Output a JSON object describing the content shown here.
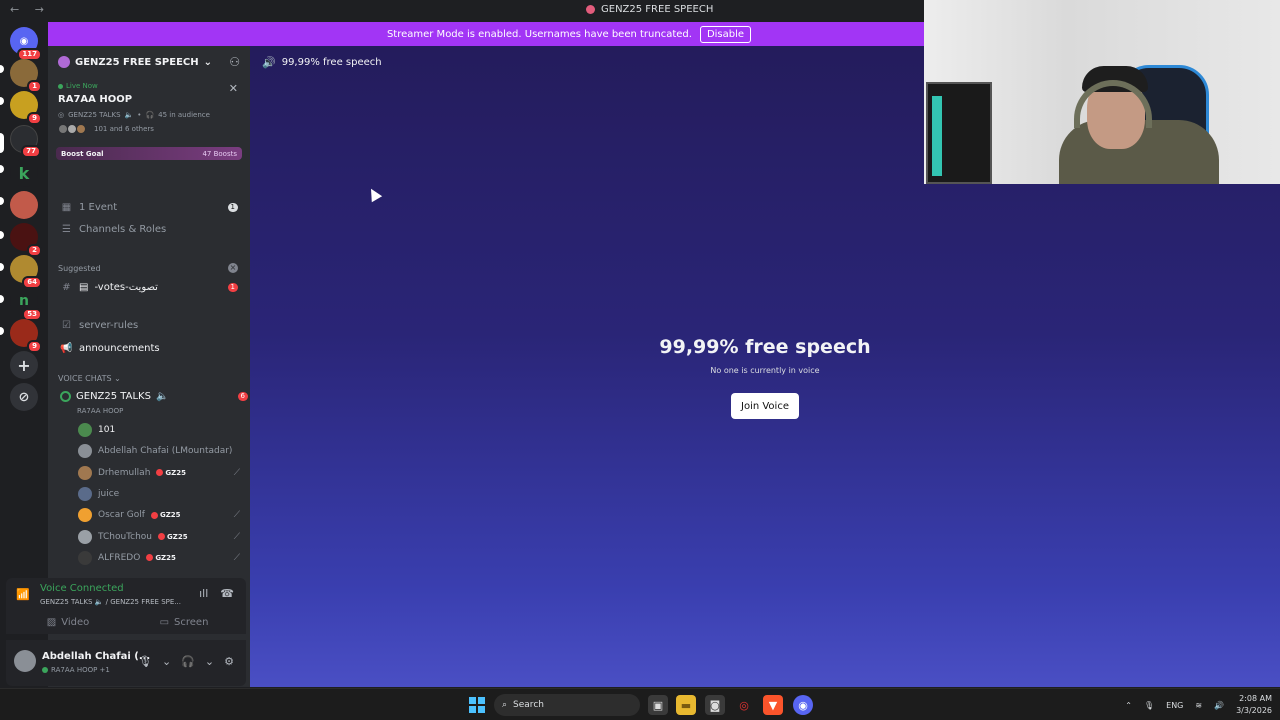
{
  "titlebar": {
    "title": "GENZ25 FREE SPEECH",
    "nav": "← →"
  },
  "streamer": {
    "message": "Streamer Mode is enabled. Usernames have been truncated.",
    "button": "Disable"
  },
  "rail": {
    "badges": [
      "117",
      "1",
      "9",
      "77",
      "2",
      "64",
      "53",
      "9"
    ]
  },
  "sidebar": {
    "server_name": "GENZ25 FREE SPEECH",
    "live": {
      "label": "Live Now",
      "who": "RA7AA HOOP",
      "channel": "GENZ25 TALKS",
      "audience": "45 in audience",
      "others": "101 and 6 others"
    },
    "boost": {
      "label": "Boost Goal",
      "count": "47 Boosts"
    },
    "events": {
      "label": "1 Event",
      "count": "1"
    },
    "channels_roles": "Channels & Roles",
    "suggested": {
      "label": "Suggested",
      "channel": "-votes-تصويت",
      "count": "1"
    },
    "server_rules": "server-rules",
    "announcements": "announcements",
    "voice_category": "VOICE CHATS",
    "voice_channel": {
      "name": "GENZ25 TALKS",
      "count": "6",
      "host": "RA7AA HOOP"
    },
    "members": [
      {
        "name": "101",
        "tag": "",
        "color": "#4b8a4e"
      },
      {
        "name": "Abdellah Chafai (LMountadar)",
        "tag": "",
        "color": "#8a8f96"
      },
      {
        "name": "Drhemullah",
        "tag": "GZ25",
        "color": "#a07850"
      },
      {
        "name": "juice",
        "tag": "",
        "color": "#5a6b8a"
      },
      {
        "name": "Oscar Golf",
        "tag": "GZ25",
        "color": "#f0a030"
      },
      {
        "name": "TChouTchou",
        "tag": "GZ25",
        "color": "#9aa0a6"
      },
      {
        "name": "ALFREDO",
        "tag": "GZ25",
        "color": "#3a3a3a"
      }
    ]
  },
  "voice_panel": {
    "status": "Voice Connected",
    "where": "GENZ25 TALKS 🔈 / GENZ25 FREE SPE...",
    "video": "Video",
    "screen": "Screen"
  },
  "user_panel": {
    "name": "Abdellah Chafai (...",
    "status": "RA7AA HOOP +1"
  },
  "main": {
    "header": "99,99% free speech",
    "title": "99,99% free speech",
    "subtitle": "No one is currently in voice",
    "join": "Join Voice"
  },
  "taskbar": {
    "search": "Search",
    "lang": "ENG",
    "time": "2:08 AM",
    "date": "3/3/2026"
  }
}
